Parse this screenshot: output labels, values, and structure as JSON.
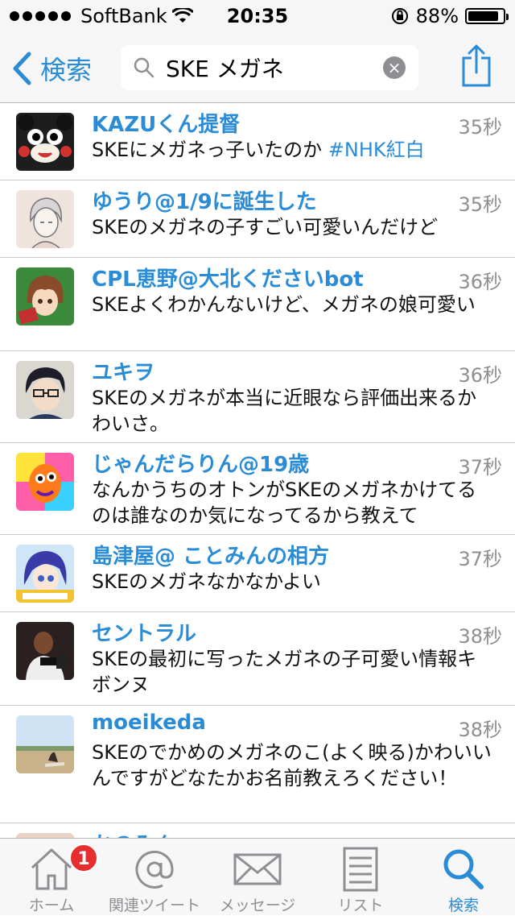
{
  "status": {
    "carrier": "SoftBank",
    "time": "20:35",
    "battery": "88%",
    "battery_level": 0.88
  },
  "nav": {
    "back_label": "検索",
    "search_value": "SKE メガネ"
  },
  "tweets": [
    {
      "name": "KAZUくん提督",
      "time": "35秒",
      "text": "SKEにメガネっ子いたのか",
      "hashtag": "#NHK紅白"
    },
    {
      "name": "ゆうり@1/9に誕生した",
      "time": "35秒",
      "text": "SKEのメガネの子すごい可愛いんだけど",
      "hashtag": ""
    },
    {
      "name": "CPL恵野@大北くださいbot",
      "time": "36秒",
      "text": "SKEよくわかんないけど、メガネの娘可愛い",
      "hashtag": ""
    },
    {
      "name": "ユキヲ",
      "time": "36秒",
      "text": "SKEのメガネが本当に近眼なら評価出来るかわいさ。",
      "hashtag": ""
    },
    {
      "name": "じゃんだらりん@19歳",
      "time": "37秒",
      "text": "なんかうちのオトンがSKEのメガネかけてるのは誰なのか気になってるから教えて",
      "hashtag": ""
    },
    {
      "name": "島津屋@ ことみんの相方",
      "time": "37秒",
      "text": "SKEのメガネなかなかよい",
      "hashtag": ""
    },
    {
      "name": "セントラル",
      "time": "38秒",
      "text": "SKEの最初に写ったメガネの子可愛い情報キボンヌ",
      "hashtag": ""
    },
    {
      "name": "moeikeda",
      "time": "38秒",
      "text": "SKEのでかめのメガネのこ(よく映る)かわいいんですがどなたかお名前教えろください！",
      "hashtag": ""
    },
    {
      "name": "かのみん",
      "time": "",
      "text": "",
      "hashtag": ""
    }
  ],
  "tabbar": {
    "home": "ホーム",
    "home_badge": "1",
    "mentions": "関連ツイート",
    "messages": "メッセージ",
    "lists": "リスト",
    "search": "検索"
  },
  "colors": {
    "accent": "#2a8cd7",
    "badge": "#e62e2e"
  }
}
